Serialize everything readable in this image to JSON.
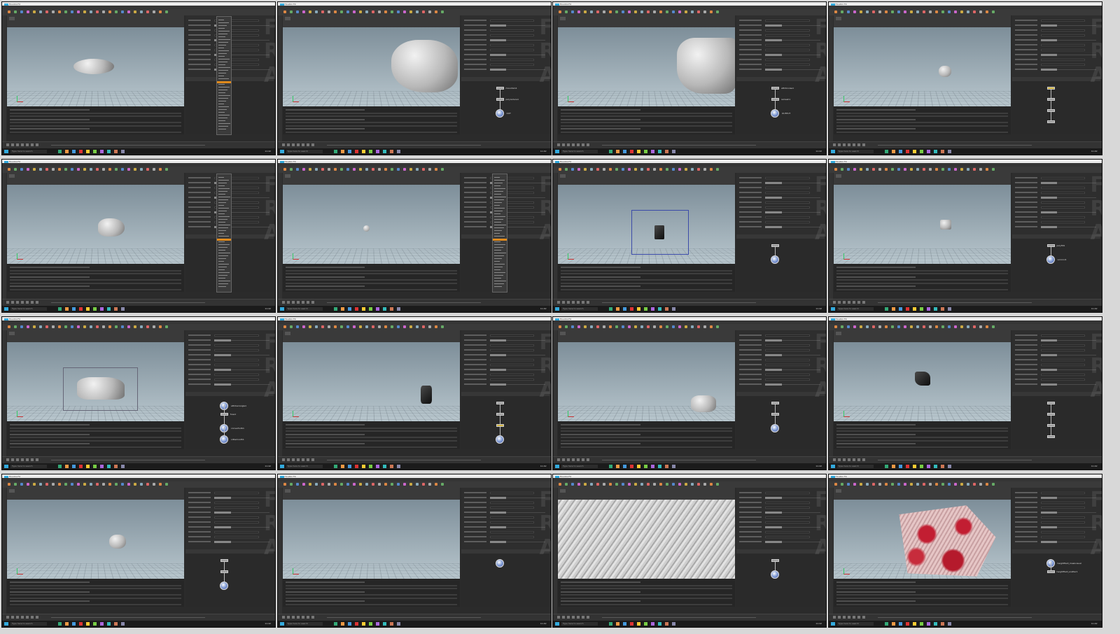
{
  "app": {
    "title_text": "Houdini FX",
    "taskbar_search": "Type here to search",
    "clock": "11:42"
  },
  "watermark_text": "FRA",
  "tiles": [
    {
      "id": "t1",
      "kind": "disk",
      "menu": true,
      "nodes": []
    },
    {
      "id": "t2",
      "kind": "bigrock",
      "menu": false,
      "nodes": [
        {
          "t": "n",
          "label": "mountain1"
        },
        {
          "t": "n",
          "label": "polyreduce1"
        },
        {
          "t": "b",
          "label": "OUT"
        }
      ]
    },
    {
      "id": "t3",
      "kind": "closerock",
      "menu": false,
      "nodes": [
        {
          "t": "n",
          "label": "attribnoise1"
        },
        {
          "t": "n",
          "label": "remesh1"
        },
        {
          "t": "b",
          "label": "OUTPUT"
        }
      ]
    },
    {
      "id": "t4",
      "kind": "smallrock",
      "menu": false,
      "nodes": [
        {
          "t": "y",
          "label": ""
        },
        {
          "t": "n",
          "label": ""
        },
        {
          "t": "n",
          "label": ""
        },
        {
          "t": "n",
          "label": ""
        }
      ]
    },
    {
      "id": "t5",
      "kind": "rock",
      "menu": true,
      "nodes": []
    },
    {
      "id": "t6",
      "kind": "tiny",
      "menu": true,
      "nodes": []
    },
    {
      "id": "t7",
      "kind": "bbox",
      "menu": false,
      "nodes": [
        {
          "t": "n",
          "label": ""
        },
        {
          "t": "b",
          "label": ""
        }
      ]
    },
    {
      "id": "t8",
      "kind": "faceted",
      "menu": false,
      "nodes": [
        {
          "t": "n",
          "label": "polyfill1"
        },
        {
          "t": "b",
          "label": "voronoi1"
        }
      ]
    },
    {
      "id": "t9",
      "kind": "flatrock",
      "menu": false,
      "nodes": [
        {
          "t": "b",
          "label": "attribwrangle1"
        },
        {
          "t": "n",
          "label": "fuse1"
        },
        {
          "t": "b",
          "label": "convertvdb1"
        },
        {
          "t": "b",
          "label": "vdbsmooth1"
        }
      ]
    },
    {
      "id": "t10",
      "kind": "darkshard",
      "menu": false,
      "nodes": [
        {
          "t": "n",
          "label": ""
        },
        {
          "t": "n",
          "label": ""
        },
        {
          "t": "y",
          "label": ""
        },
        {
          "t": "b",
          "label": ""
        }
      ]
    },
    {
      "id": "t11",
      "kind": "darkrock",
      "menu": false,
      "nodes": [
        {
          "t": "n",
          "label": ""
        },
        {
          "t": "n",
          "label": ""
        },
        {
          "t": "b",
          "label": ""
        }
      ]
    },
    {
      "id": "t12",
      "kind": "blackrock",
      "menu": false,
      "nodes": [
        {
          "t": "n",
          "label": ""
        },
        {
          "t": "n",
          "label": ""
        },
        {
          "t": "n",
          "label": ""
        },
        {
          "t": "n",
          "label": ""
        }
      ]
    },
    {
      "id": "t13",
      "kind": "greyrock",
      "menu": false,
      "nodes": [
        {
          "t": "n",
          "label": ""
        },
        {
          "t": "n",
          "label": ""
        },
        {
          "t": "b",
          "label": ""
        }
      ]
    },
    {
      "id": "t14",
      "kind": "empty",
      "menu": false,
      "nodes": [
        {
          "t": "b",
          "label": ""
        }
      ]
    },
    {
      "id": "t15",
      "kind": "terrain",
      "menu": false,
      "nodes": [
        {
          "t": "n",
          "label": ""
        },
        {
          "t": "b",
          "label": ""
        }
      ]
    },
    {
      "id": "t16",
      "kind": "redterrain",
      "menu": false,
      "nodes": [
        {
          "t": "b",
          "label": "heightfield_maskvisual"
        },
        {
          "t": "n",
          "label": "heightfield_scatter1"
        }
      ]
    }
  ]
}
